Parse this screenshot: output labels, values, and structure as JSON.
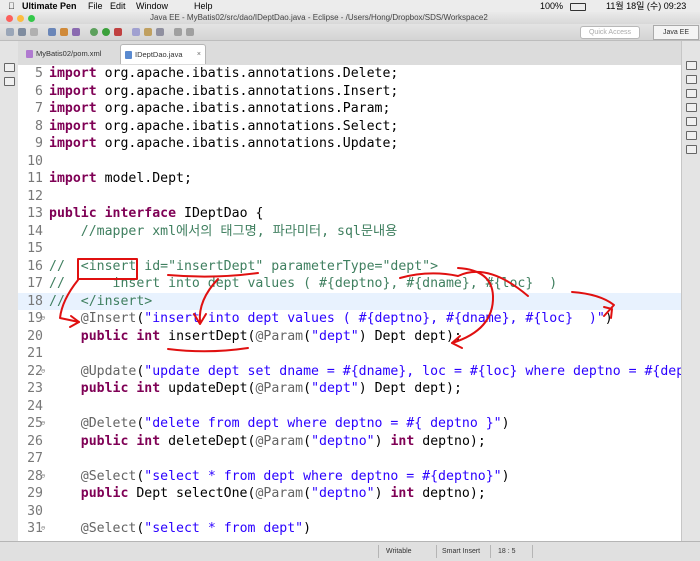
{
  "menubar": {
    "app": "Ultimate Pen",
    "items": [
      "File",
      "Edit",
      "Window",
      "Help"
    ],
    "status_right": "100%",
    "datetime": "11월 18일 (수)  09:23"
  },
  "window": {
    "title": "Java EE - MyBatis02/src/dao/IDeptDao.java - Eclipse - /Users/Hong/Dropbox/SDS/Workspace2"
  },
  "toolbar": {
    "quick_access": "Quick Access",
    "perspective": "Java EE"
  },
  "tabs": [
    {
      "label": "MyBatis02/pom.xml"
    },
    {
      "label": "IDeptDao.java"
    }
  ],
  "code": {
    "lines": [
      {
        "n": "5",
        "fold": "",
        "text": "import org.apache.ibatis.annotations.Delete;"
      },
      {
        "n": "6",
        "fold": "",
        "text": "import org.apache.ibatis.annotations.Insert;"
      },
      {
        "n": "7",
        "fold": "",
        "text": "import org.apache.ibatis.annotations.Param;"
      },
      {
        "n": "8",
        "fold": "",
        "text": "import org.apache.ibatis.annotations.Select;"
      },
      {
        "n": "9",
        "fold": "",
        "text": "import org.apache.ibatis.annotations.Update;"
      },
      {
        "n": "10",
        "fold": "",
        "text": ""
      },
      {
        "n": "11",
        "fold": "",
        "text": "import model.Dept;"
      },
      {
        "n": "12",
        "fold": "",
        "text": ""
      },
      {
        "n": "13",
        "fold": "",
        "text": "public interface IDeptDao {"
      },
      {
        "n": "14",
        "fold": "",
        "text": "    //mapper xml에서의 태그명, 파라미터, sql문내용"
      },
      {
        "n": "15",
        "fold": "",
        "text": ""
      },
      {
        "n": "16",
        "fold": "",
        "text": "//  <insert id=\"insertDept\" parameterType=\"dept\">"
      },
      {
        "n": "17",
        "fold": "",
        "text": "//      insert into dept values ( #{deptno}, #{dname}, #{loc}  )"
      },
      {
        "n": "18",
        "fold": "",
        "text": "//  </insert>"
      },
      {
        "n": "19",
        "fold": "⊖",
        "text": "    @Insert(\"insert into dept values ( #{deptno}, #{dname}, #{loc}  )\")"
      },
      {
        "n": "20",
        "fold": "",
        "text": "    public int insertDept(@Param(\"dept\") Dept dept);"
      },
      {
        "n": "21",
        "fold": "",
        "text": ""
      },
      {
        "n": "22",
        "fold": "⊖",
        "text": "    @Update(\"update dept set dname = #{dname}, loc = #{loc} where deptno = #{deptno}\")"
      },
      {
        "n": "23",
        "fold": "",
        "text": "    public int updateDept(@Param(\"dept\") Dept dept);"
      },
      {
        "n": "24",
        "fold": "",
        "text": ""
      },
      {
        "n": "25",
        "fold": "⊖",
        "text": "    @Delete(\"delete from dept where deptno = #{ deptno }\")"
      },
      {
        "n": "26",
        "fold": "",
        "text": "    public int deleteDept(@Param(\"deptno\") int deptno);"
      },
      {
        "n": "27",
        "fold": "",
        "text": ""
      },
      {
        "n": "28",
        "fold": "⊖",
        "text": "    @Select(\"select * from dept where deptno = #{deptno}\")"
      },
      {
        "n": "29",
        "fold": "",
        "text": "    public Dept selectOne(@Param(\"deptno\") int deptno);"
      },
      {
        "n": "30",
        "fold": "",
        "text": ""
      },
      {
        "n": "31",
        "fold": "⊖",
        "text": "    @Select(\"select * from dept\")"
      }
    ],
    "highlighted_line": "18"
  },
  "status": {
    "writable": "Writable",
    "insert_mode": "Smart Insert",
    "position": "18 : 5"
  },
  "colors": {
    "keyword": "#7f0055",
    "string": "#2a00ff",
    "comment": "#3f7f5f",
    "annotation": "#646464",
    "markup_pen": "#e01010"
  }
}
